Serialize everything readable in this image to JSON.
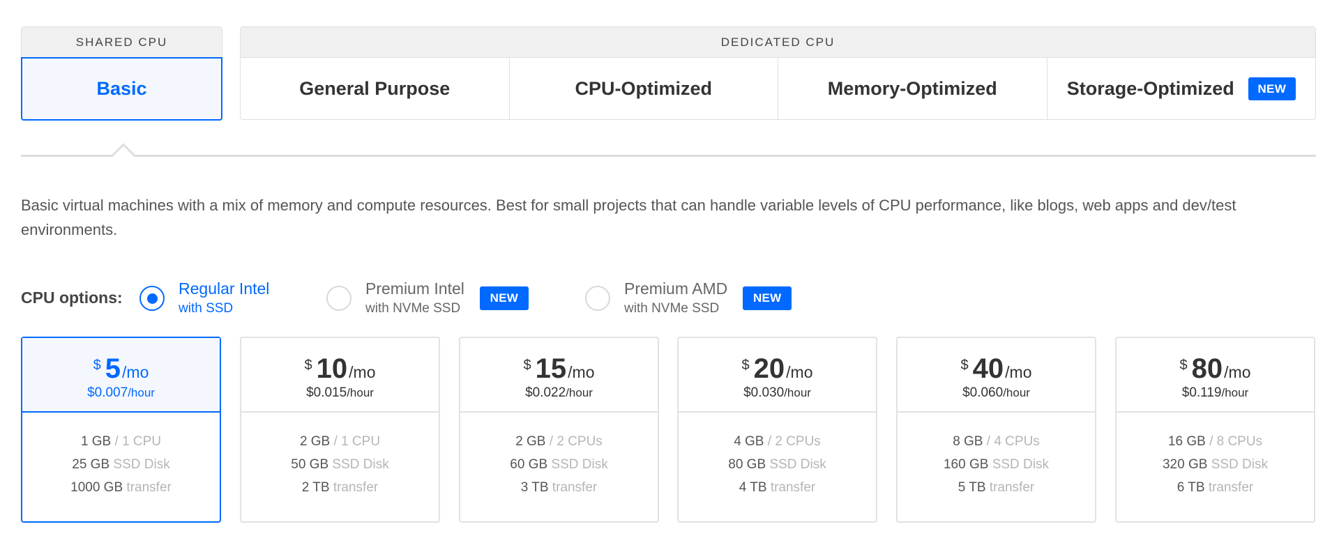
{
  "plan_groups": {
    "shared": {
      "header": "SHARED CPU",
      "tabs": [
        {
          "label": "Basic",
          "active": true
        }
      ]
    },
    "dedicated": {
      "header": "DEDICATED CPU",
      "tabs": [
        {
          "label": "General Purpose",
          "active": false
        },
        {
          "label": "CPU-Optimized",
          "active": false
        },
        {
          "label": "Memory-Optimized",
          "active": false
        },
        {
          "label": "Storage-Optimized",
          "active": false,
          "badge": "NEW"
        }
      ]
    }
  },
  "description": "Basic virtual machines with a mix of memory and compute resources. Best for small projects that can handle variable levels of CPU performance, like blogs, web apps and dev/test environments.",
  "cpu_options": {
    "label": "CPU options:",
    "options": [
      {
        "title": "Regular Intel",
        "subtitle": "with SSD",
        "selected": true
      },
      {
        "title": "Premium Intel",
        "subtitle": "with NVMe SSD",
        "selected": false,
        "badge": "NEW"
      },
      {
        "title": "Premium AMD",
        "subtitle": "with NVMe SSD",
        "selected": false,
        "badge": "NEW"
      }
    ]
  },
  "plans": [
    {
      "currency": "$",
      "monthly": "5",
      "monthly_unit": "/mo",
      "hourly": "$0.007",
      "hourly_unit": "/hour",
      "selected": true,
      "memory": "1 GB",
      "cpu": "/ 1 CPU",
      "disk": "25 GB",
      "disk_label": "SSD Disk",
      "transfer": "1000 GB",
      "transfer_label": "transfer"
    },
    {
      "currency": "$",
      "monthly": "10",
      "monthly_unit": "/mo",
      "hourly": "$0.015",
      "hourly_unit": "/hour",
      "selected": false,
      "memory": "2 GB",
      "cpu": "/ 1 CPU",
      "disk": "50 GB",
      "disk_label": "SSD Disk",
      "transfer": "2 TB",
      "transfer_label": "transfer"
    },
    {
      "currency": "$",
      "monthly": "15",
      "monthly_unit": "/mo",
      "hourly": "$0.022",
      "hourly_unit": "/hour",
      "selected": false,
      "memory": "2 GB",
      "cpu": "/ 2 CPUs",
      "disk": "60 GB",
      "disk_label": "SSD Disk",
      "transfer": "3 TB",
      "transfer_label": "transfer"
    },
    {
      "currency": "$",
      "monthly": "20",
      "monthly_unit": "/mo",
      "hourly": "$0.030",
      "hourly_unit": "/hour",
      "selected": false,
      "memory": "4 GB",
      "cpu": "/ 2 CPUs",
      "disk": "80 GB",
      "disk_label": "SSD Disk",
      "transfer": "4 TB",
      "transfer_label": "transfer"
    },
    {
      "currency": "$",
      "monthly": "40",
      "monthly_unit": "/mo",
      "hourly": "$0.060",
      "hourly_unit": "/hour",
      "selected": false,
      "memory": "8 GB",
      "cpu": "/ 4 CPUs",
      "disk": "160 GB",
      "disk_label": "SSD Disk",
      "transfer": "5 TB",
      "transfer_label": "transfer"
    },
    {
      "currency": "$",
      "monthly": "80",
      "monthly_unit": "/mo",
      "hourly": "$0.119",
      "hourly_unit": "/hour",
      "selected": false,
      "memory": "16 GB",
      "cpu": "/ 8 CPUs",
      "disk": "320 GB",
      "disk_label": "SSD Disk",
      "transfer": "6 TB",
      "transfer_label": "transfer"
    }
  ],
  "colors": {
    "accent": "#0069ff",
    "selected_bg": "#f4f8fe",
    "border": "#dfdfdf",
    "header_bg": "#f0f0f0",
    "muted_text": "#b5b5b5"
  }
}
